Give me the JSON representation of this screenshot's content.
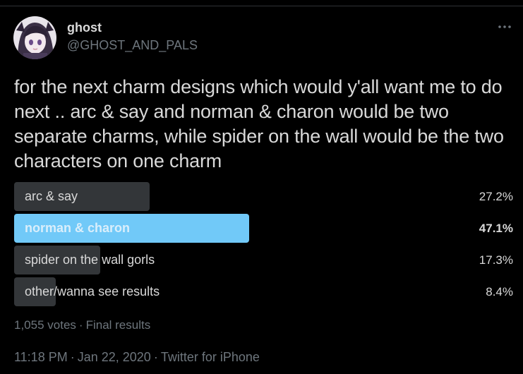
{
  "author": {
    "display_name": "ghost",
    "handle": "@GHOST_AND_PALS",
    "avatar_icon": "profile-avatar"
  },
  "more_icon": "more-options-icon",
  "tweet": {
    "text": "for the next charm designs which would y'all want me to do next .. arc & say and norman & charon would be two separate charms, while spider on the wall would be the two characters on one charm"
  },
  "poll": {
    "options": [
      {
        "label": "arc & say",
        "percent_text": "27.2%",
        "percent": 27.2,
        "winner": false
      },
      {
        "label": "norman & charon",
        "percent_text": "47.1%",
        "percent": 47.1,
        "winner": true
      },
      {
        "label": "spider on the wall gorls",
        "percent_text": "17.3%",
        "percent": 17.3,
        "winner": false
      },
      {
        "label": "other/wanna see results",
        "percent_text": "8.4%",
        "percent": 8.4,
        "winner": false
      }
    ],
    "votes": "1,055 votes",
    "status": "Final results"
  },
  "meta": {
    "time": "11:18 PM",
    "date": "Jan 22, 2020",
    "source": "Twitter for iPhone"
  },
  "colors": {
    "background": "#000000",
    "text": "#d9d9d9",
    "muted": "#6e767d",
    "bar": "#333639",
    "winner_bar": "#71c9f8"
  }
}
